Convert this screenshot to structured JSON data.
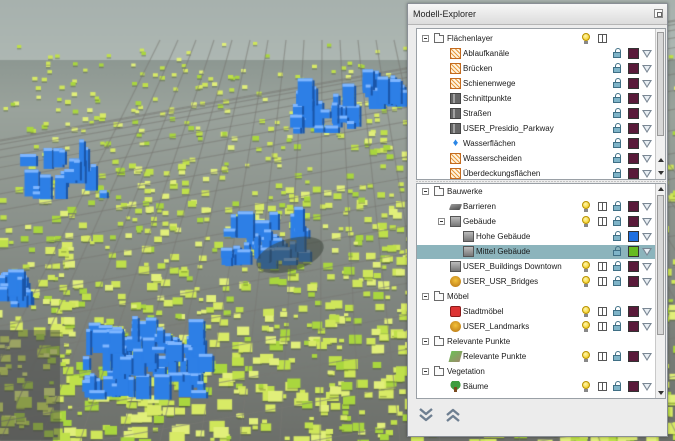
{
  "panel": {
    "title": "Modell-Explorer"
  },
  "icons": {
    "dock": "dock-float-icon",
    "expand_down": "double-chevron-down-icon",
    "collapse_up": "double-chevron-up-icon"
  },
  "tree_top": {
    "root": {
      "label": "Flächenlayer"
    },
    "items": [
      {
        "label": "Ablaufkanäle",
        "icon": "hatch-area-icon",
        "color": "#5a1a3a"
      },
      {
        "label": "Brücken",
        "icon": "hatch-area-icon",
        "color": "#5a1a3a"
      },
      {
        "label": "Schienenwege",
        "icon": "hatch-area-icon",
        "color": "#5a1a3a"
      },
      {
        "label": "Schnittpunkte",
        "icon": "road-icon",
        "color": "#5a1a3a"
      },
      {
        "label": "Straßen",
        "icon": "road-icon",
        "color": "#5a1a3a"
      },
      {
        "label": "USER_Presidio_Parkway",
        "icon": "road-icon",
        "color": "#5a1a3a"
      },
      {
        "label": "Wasserflächen",
        "icon": "water-drop-icon",
        "color": "#5a1a3a"
      },
      {
        "label": "Wasserscheiden",
        "icon": "hatch-area-icon",
        "color": "#5a1a3a"
      },
      {
        "label": "Überdeckungsflächen",
        "icon": "hatch-area-icon",
        "color": "#5a1a3a"
      }
    ]
  },
  "tree_bottom": {
    "groups": [
      {
        "label": "Bauwerke",
        "items": [
          {
            "label": "Barrieren",
            "icon": "wall-icon",
            "color": "#5a1a3a"
          },
          {
            "label": "Gebäude",
            "icon": "building-icon",
            "color": "#5a1a3a",
            "children": [
              {
                "label": "Hohe Gebäude",
                "icon": "building-icon",
                "color": "#1f6fe0"
              },
              {
                "label": "Mittel Gebäude",
                "icon": "building-icon",
                "color": "#66bb22",
                "selected": true
              }
            ]
          },
          {
            "label": "USER_Buildings Downtown",
            "icon": "building-icon",
            "color": "#5a1a3a"
          },
          {
            "label": "USER_USR_Bridges",
            "icon": "landmark-icon",
            "color": "#5a1a3a"
          }
        ]
      },
      {
        "label": "Möbel",
        "items": [
          {
            "label": "Stadtmöbel",
            "icon": "bench-icon",
            "color": "#5a1a3a"
          },
          {
            "label": "USER_Landmarks",
            "icon": "landmark-icon",
            "color": "#5a1a3a"
          }
        ]
      },
      {
        "label": "Relevante Punkte",
        "items": [
          {
            "label": "Relevante Punkte",
            "icon": "poi-icon",
            "color": "#5a1a3a"
          }
        ]
      },
      {
        "label": "Vegetation",
        "items": [
          {
            "label": "Bäume",
            "icon": "tree-icon",
            "color": "#5a1a3a"
          }
        ]
      }
    ]
  }
}
